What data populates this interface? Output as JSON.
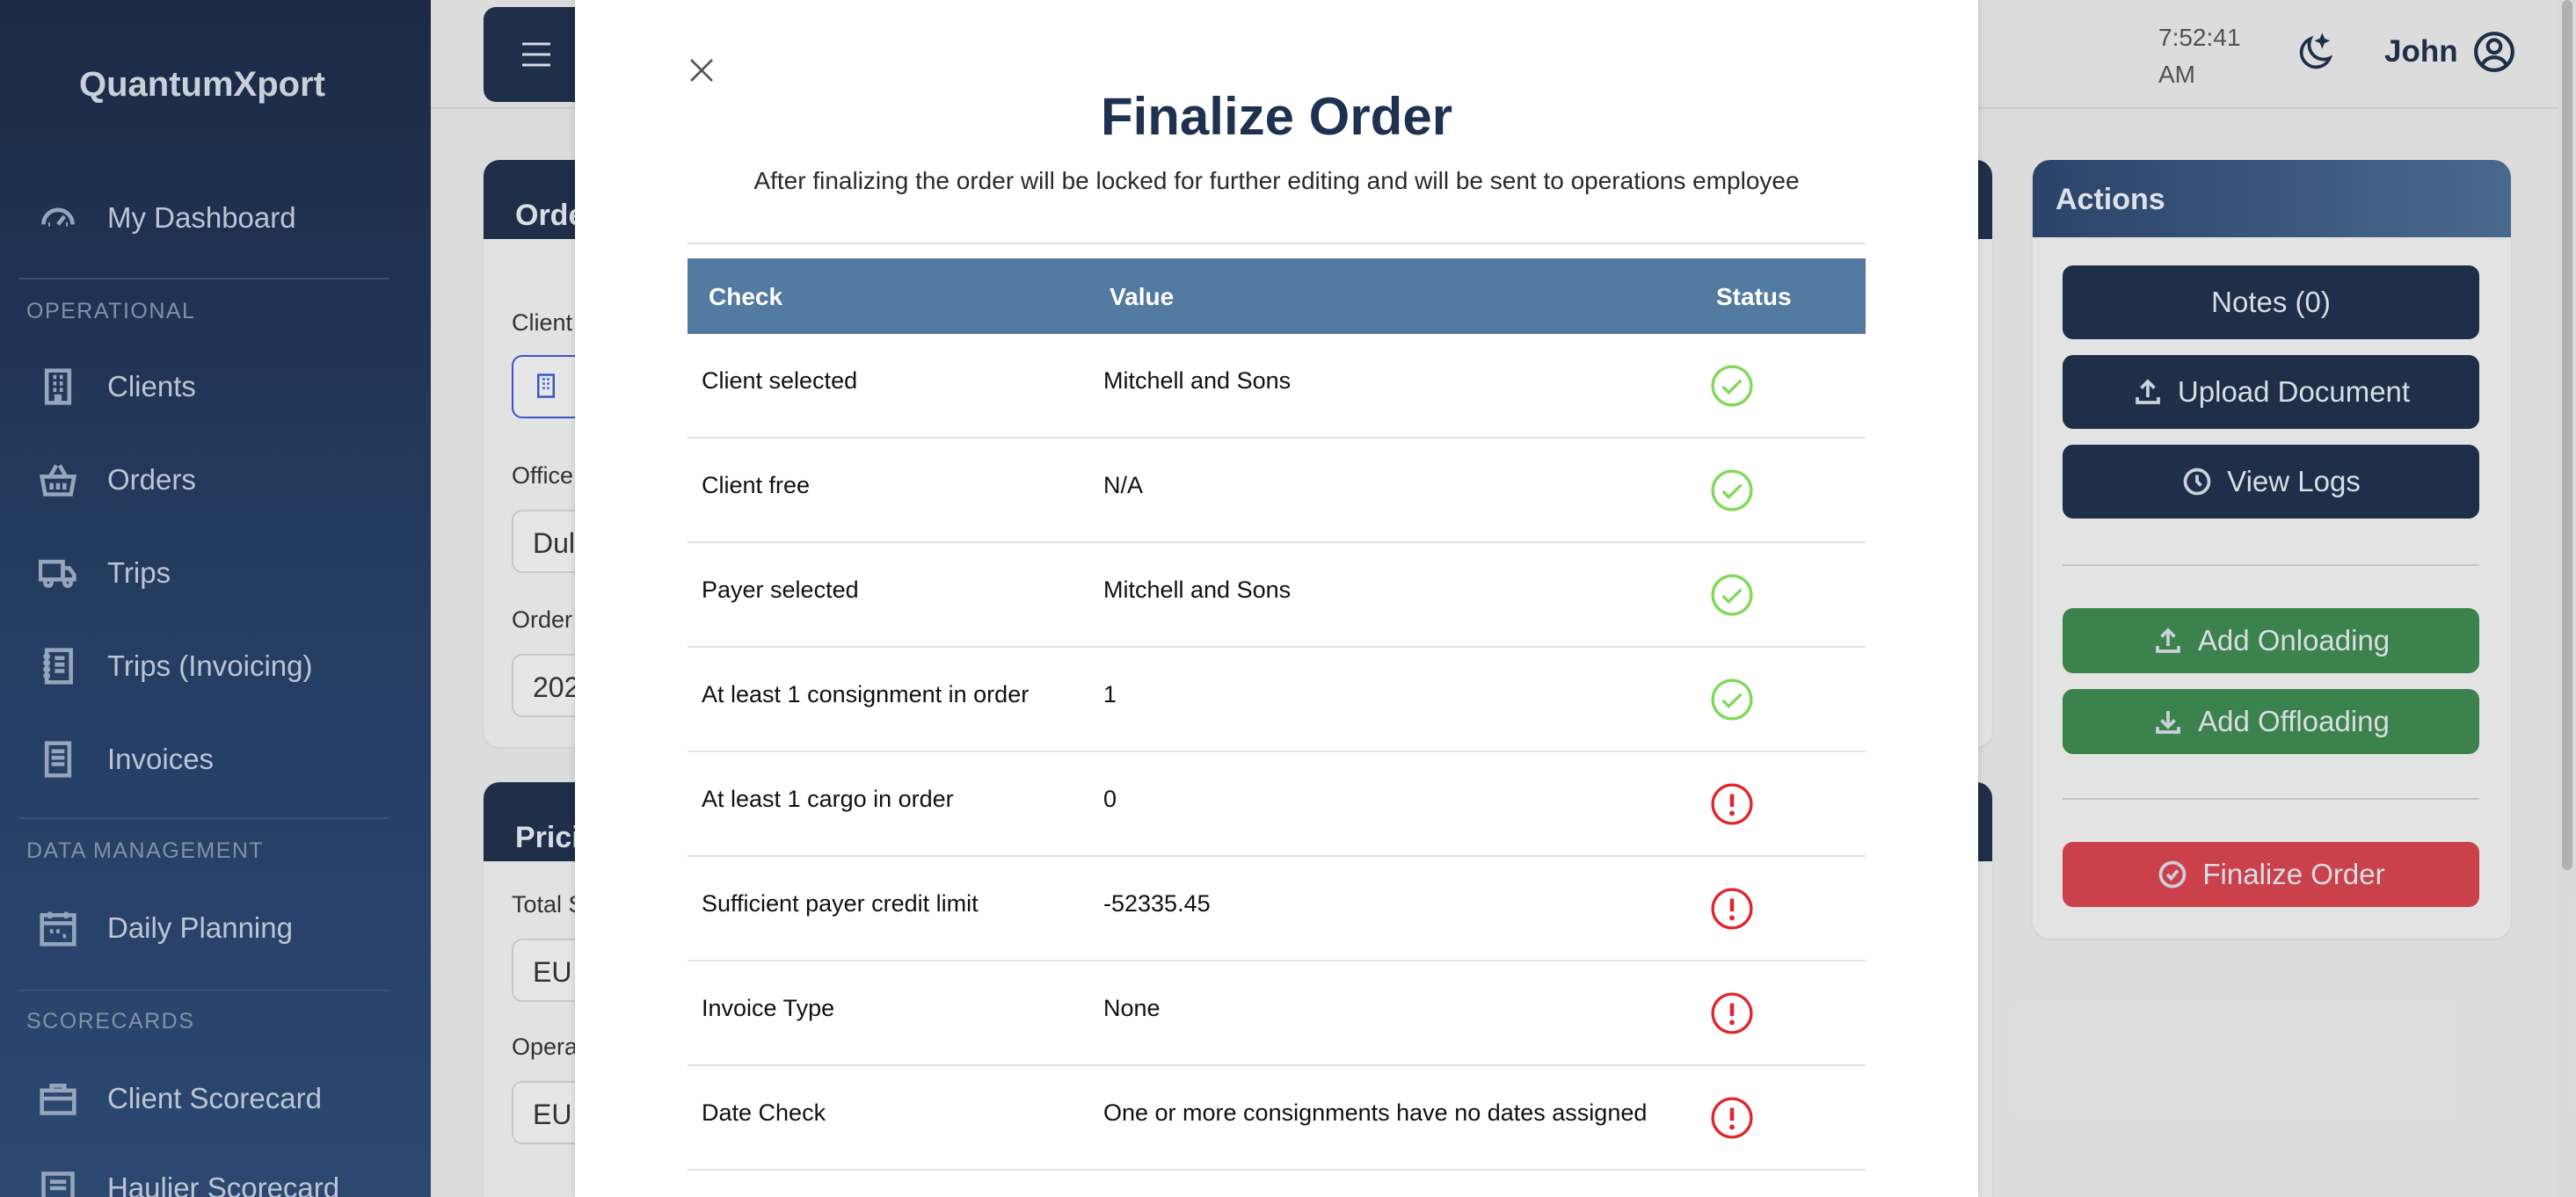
{
  "sidebar": {
    "brand": "QuantumXport",
    "items": [
      {
        "label": "My Dashboard",
        "icon": "dashboard-gauge-icon"
      },
      {
        "label": "Clients",
        "icon": "building-icon"
      },
      {
        "label": "Orders",
        "icon": "basket-icon"
      },
      {
        "label": "Trips",
        "icon": "truck-icon"
      },
      {
        "label": "Trips (Invoicing)",
        "icon": "journal-icon"
      },
      {
        "label": "Invoices",
        "icon": "document-icon"
      },
      {
        "label": "Daily Planning",
        "icon": "calendar-icon"
      },
      {
        "label": "Client Scorecard",
        "icon": "briefcase-icon"
      },
      {
        "label": "Haulier Scorecard",
        "icon": "scorecard-icon"
      }
    ],
    "sections": {
      "operational": "OPERATIONAL",
      "data_management": "DATA MANAGEMENT",
      "scorecards": "SCORECARDS"
    }
  },
  "topbar": {
    "time": "7:52:41",
    "ampm": "AM",
    "user": "John"
  },
  "background_form": {
    "order_card_title": "Orde",
    "client_label": "Client",
    "office_label": "Office",
    "office_value": "Dul",
    "order_label": "Order",
    "order_value": "202",
    "pricing_card_title": "Prici",
    "total_label": "Total S",
    "total_value": "EU",
    "operational_label": "Opera",
    "operational_value": "EU"
  },
  "actions": {
    "title": "Actions",
    "notes": "Notes (0)",
    "upload": "Upload Document",
    "logs": "View Logs",
    "onloading": "Add Onloading",
    "offloading": "Add Offloading",
    "finalize": "Finalize Order"
  },
  "modal": {
    "title": "Finalize Order",
    "subtitle": "After finalizing the order will be locked for further editing and will be sent to operations employee",
    "headers": {
      "check": "Check",
      "value": "Value",
      "status": "Status"
    },
    "rows": [
      {
        "check": "Client selected",
        "value": "Mitchell and Sons",
        "status": "ok"
      },
      {
        "check": "Client free",
        "value": "N/A",
        "status": "ok"
      },
      {
        "check": "Payer selected",
        "value": "Mitchell and Sons",
        "status": "ok"
      },
      {
        "check": "At least 1 consignment in order",
        "value": "1",
        "status": "ok"
      },
      {
        "check": "At least 1 cargo in order",
        "value": "0",
        "status": "error"
      },
      {
        "check": "Sufficient payer credit limit",
        "value": "-52335.45",
        "status": "error"
      },
      {
        "check": "Invoice Type",
        "value": "None",
        "status": "error"
      },
      {
        "check": "Date Check",
        "value": "One or more consignments have no dates assigned",
        "status": "error"
      }
    ]
  },
  "colors": {
    "ok": "#7ed957",
    "error": "#e0262b",
    "navy": "#1f2f4d",
    "table_header": "#537aa0"
  }
}
